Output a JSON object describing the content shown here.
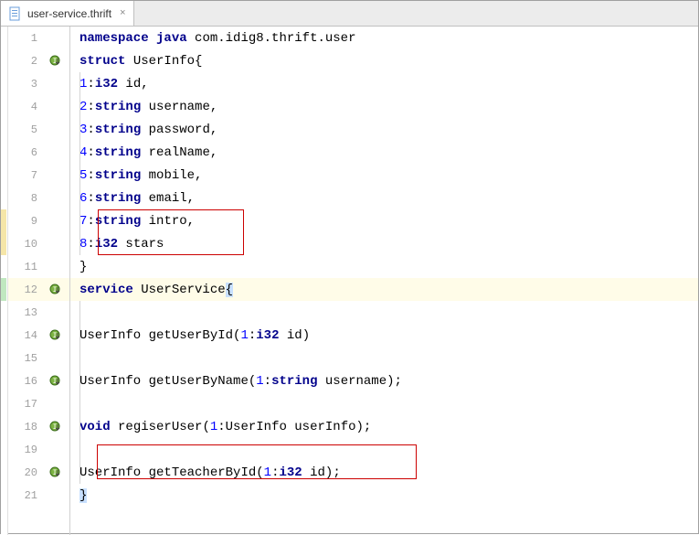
{
  "tab": {
    "label": "user-service.thrift"
  },
  "lines": {
    "l1": {
      "num": "1"
    },
    "l2": {
      "num": "2"
    },
    "l3": {
      "num": "3",
      "field": "1",
      "type": "i32",
      "name": " id,"
    },
    "l4": {
      "num": "4",
      "field": "2",
      "type": "string",
      "name": " username,"
    },
    "l5": {
      "num": "5",
      "field": "3",
      "type": "string",
      "name": " password,"
    },
    "l6": {
      "num": "6",
      "field": "4",
      "type": "string",
      "name": " realName,"
    },
    "l7": {
      "num": "7",
      "field": "5",
      "type": "string",
      "name": " mobile,"
    },
    "l8": {
      "num": "8",
      "field": "6",
      "type": "string",
      "name": " email,"
    },
    "l9": {
      "num": "9",
      "field": "7",
      "type": "string",
      "name": " intro,"
    },
    "l10": {
      "num": "10",
      "field": "8",
      "type": "i32",
      "name": " stars"
    },
    "l11": {
      "num": "11"
    },
    "l12": {
      "num": "12"
    },
    "l13": {
      "num": "13"
    },
    "l14": {
      "num": "14",
      "ret": "UserInfo ",
      "fn": "getUserById",
      "pnum": "1",
      "ptype": "i32",
      "pname": " id"
    },
    "l15": {
      "num": "15"
    },
    "l16": {
      "num": "16",
      "ret": "UserInfo ",
      "fn": "getUserByName",
      "pnum": "1",
      "ptype": "string",
      "pname": " username"
    },
    "l17": {
      "num": "17"
    },
    "l18": {
      "num": "18",
      "ret": "void",
      "fn": " regiserUser",
      "pnum": "1",
      "ptype": "UserInfo ",
      "pname": "userInfo"
    },
    "l19": {
      "num": "19"
    },
    "l20": {
      "num": "20",
      "ret": "UserInfo ",
      "fn": "getTeacherById",
      "pnum": "1",
      "ptype": "i32",
      "pname": " id"
    },
    "l21": {
      "num": "21"
    }
  },
  "kw": {
    "namespace": "namespace",
    "java": "java",
    "pkg": " com.idig8.thrift.user",
    "struct": "struct",
    "userinfo": " UserInfo",
    "service": "service",
    "userservice": " UserService"
  }
}
